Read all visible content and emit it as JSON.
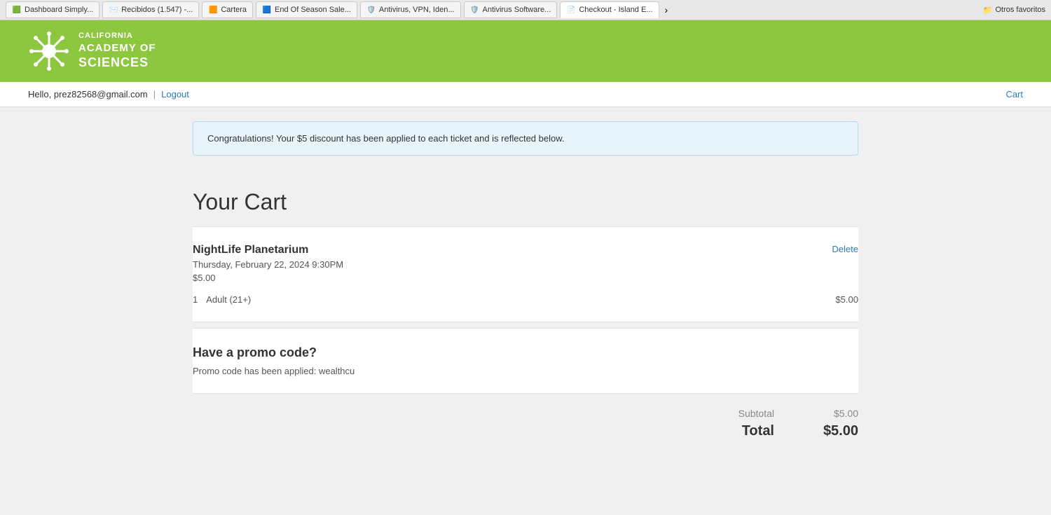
{
  "browser": {
    "tabs": [
      {
        "id": "tab-dashboard",
        "label": "Dashboard Simply...",
        "icon": "🟩",
        "active": false
      },
      {
        "id": "tab-recibidos",
        "label": "Recibidos (1.547) -...",
        "icon": "✉️",
        "active": false
      },
      {
        "id": "tab-cartera",
        "label": "Cartera",
        "icon": "🟧",
        "active": false
      },
      {
        "id": "tab-endofseason",
        "label": "End Of Season Sale...",
        "icon": "🟦",
        "active": false
      },
      {
        "id": "tab-antivirus1",
        "label": "Antivirus, VPN, Iden...",
        "icon": "🛡️",
        "active": false
      },
      {
        "id": "tab-antivirus2",
        "label": "Antivirus Software...",
        "icon": "🛡️",
        "active": false
      },
      {
        "id": "tab-checkout",
        "label": "Checkout - Island E...",
        "icon": "📄",
        "active": true
      }
    ],
    "more_label": "›",
    "favorites_label": "Otros favoritos"
  },
  "header": {
    "logo_line1": "CALIFORNIA",
    "logo_line2": "ACADEMY OF",
    "logo_line3": "SCIENCES"
  },
  "user_bar": {
    "greeting": "Hello, prez82568@gmail.com",
    "separator": "|",
    "logout_label": "Logout",
    "cart_label": "Cart"
  },
  "discount_banner": {
    "message": "Congratulations! Your $5 discount has been applied to each ticket and is reflected below."
  },
  "cart": {
    "title": "Your Cart",
    "item": {
      "name": "NightLife Planetarium",
      "date": "Thursday, February 22, 2024 9:30PM",
      "price": "$5.00",
      "delete_label": "Delete",
      "tickets": [
        {
          "quantity": "1",
          "type": "Adult (21+)",
          "amount": "$5.00"
        }
      ]
    }
  },
  "promo": {
    "title": "Have a promo code?",
    "applied_message": "Promo code has been applied: wealthcu"
  },
  "totals": {
    "subtotal_label": "Subtotal",
    "subtotal_amount": "$5.00",
    "total_label": "Total",
    "total_amount": "$5.00"
  }
}
